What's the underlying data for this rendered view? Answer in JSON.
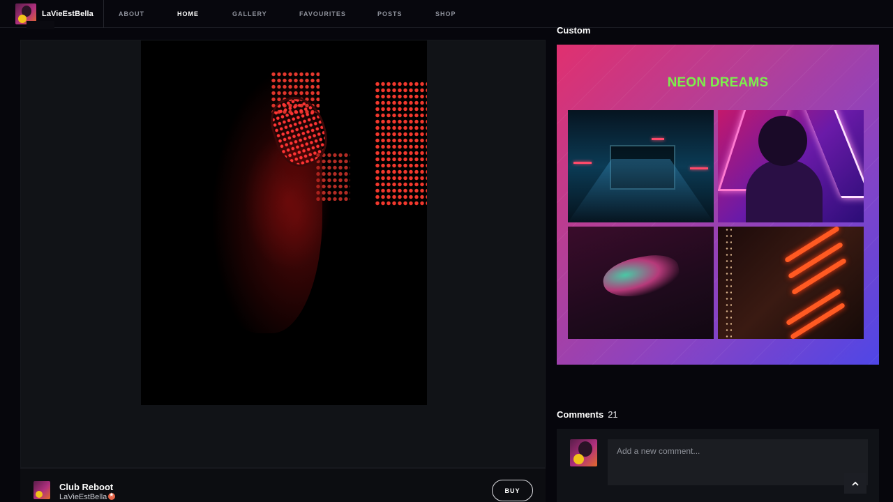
{
  "brand": {
    "name": "LaVieEstBella"
  },
  "nav": {
    "items": [
      {
        "label": "ABOUT",
        "active": false
      },
      {
        "label": "HOME",
        "active": true
      },
      {
        "label": "GALLERY",
        "active": false
      },
      {
        "label": "FAVOURITES",
        "active": false
      },
      {
        "label": "POSTS",
        "active": false
      },
      {
        "label": "SHOP",
        "active": false
      }
    ]
  },
  "media": {
    "image_icon": "neon-portrait-image",
    "title": "Club Reboot",
    "author": "LaVieEstBella",
    "buy_label": "BUY"
  },
  "custom": {
    "section_title": "Custom",
    "card_title": "NEON DREAMS",
    "title_color": "#7cf04c"
  },
  "comments": {
    "title": "Comments",
    "count": "21",
    "placeholder": "Add a new comment..."
  },
  "colors": {
    "background": "#06060c",
    "panel": "#111317",
    "accent_gradient_start": "#e0306f",
    "accent_gradient_end": "#4f46e6"
  }
}
